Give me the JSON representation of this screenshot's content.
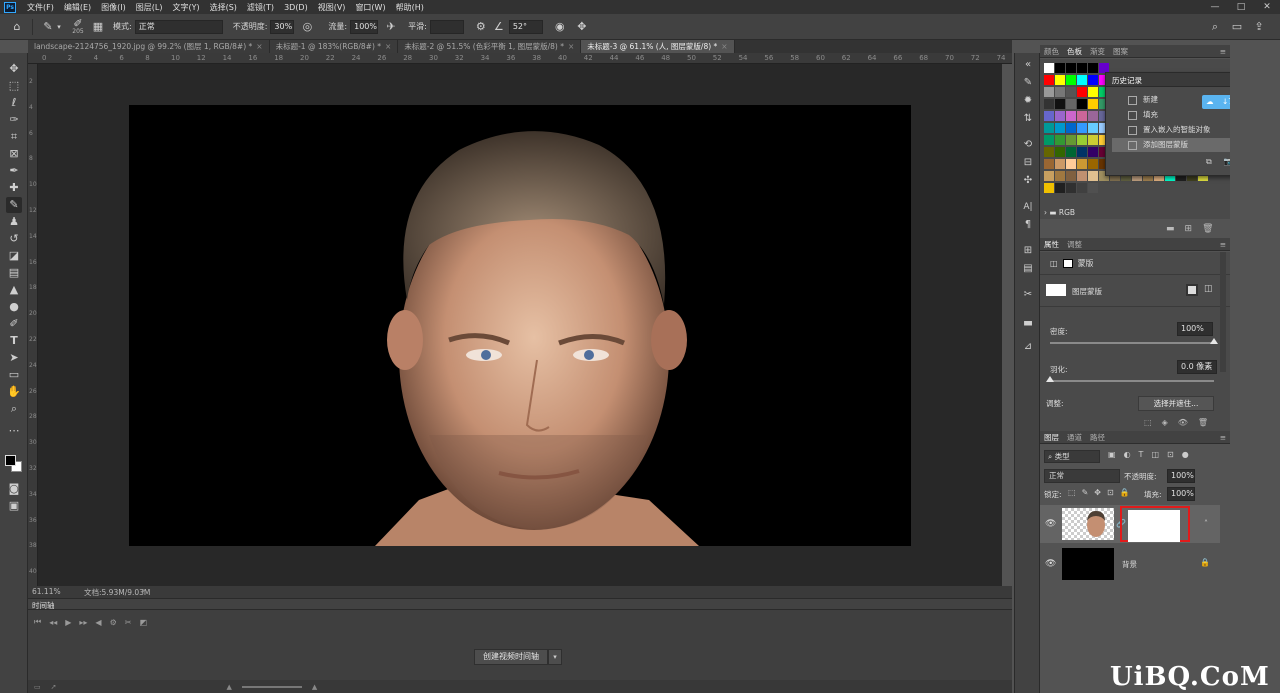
{
  "app": {
    "logo": "Ps",
    "menu": [
      "文件(F)",
      "编辑(E)",
      "图像(I)",
      "图层(L)",
      "文字(Y)",
      "选择(S)",
      "滤镜(T)",
      "3D(D)",
      "视图(V)",
      "窗口(W)",
      "帮助(H)"
    ],
    "window_controls": [
      "—",
      "□",
      "✕"
    ]
  },
  "options": {
    "brush_size": "205",
    "mode_label": "模式:",
    "mode_value": "正常",
    "opacity_label": "不透明度:",
    "opacity_value": "30%",
    "flow_label": "流量:",
    "flow_value": "100%",
    "smooth_label": "平滑:",
    "angle_value": "52°"
  },
  "tabs": [
    {
      "label": "landscape-2124756_1920.jpg @ 99.2% (图层 1, RGB/8#) *",
      "active": false
    },
    {
      "label": "未标题-1 @ 183%(RGB/8#) *",
      "active": false
    },
    {
      "label": "未标题-2 @ 51.5% (色彩平衡 1, 图层蒙版/8) *",
      "active": false
    },
    {
      "label": "未标题-3 @ 61.1% (人, 图层蒙版/8) *",
      "active": true
    }
  ],
  "ruler_h": [
    "0",
    "2",
    "4",
    "6",
    "8",
    "10",
    "12",
    "14",
    "16",
    "18",
    "20",
    "22",
    "24",
    "26",
    "28",
    "30",
    "32",
    "34",
    "36",
    "38",
    "40",
    "42",
    "44",
    "46",
    "48",
    "50",
    "52",
    "54",
    "56",
    "58",
    "60",
    "62",
    "64",
    "66",
    "68",
    "70",
    "72",
    "74"
  ],
  "ruler_v": [
    "2",
    "4",
    "6",
    "8",
    "10",
    "12",
    "14",
    "16",
    "18",
    "20",
    "22",
    "24",
    "26",
    "28",
    "30",
    "32",
    "34",
    "36",
    "38",
    "40"
  ],
  "status": {
    "zoom": "61.11%",
    "doc": "文档:5.93M/9.03M"
  },
  "timeline": {
    "title": "时间轴",
    "create_button": "创建视频时间轴"
  },
  "swatches_panel": {
    "tabs": [
      "颜色",
      "色板",
      "渐变",
      "图案"
    ],
    "active_tab": "色板",
    "folder": "RGB",
    "rows": [
      [
        "#ffffff",
        "#000000",
        "#000000",
        "#000000",
        "#000000",
        "#6600cc"
      ],
      [
        "#ff0000",
        "#ffff00",
        "#00ff00",
        "#00ffff",
        "#0000ff",
        "#ff00ff",
        "#ffffff"
      ],
      [
        "#999999",
        "#777777",
        "#555555",
        "#ff0000",
        "#ffff00",
        "#00cc66",
        "#0066ff"
      ],
      [
        "#333333",
        "#111111",
        "#666666",
        "#000000",
        "#ffcc00",
        "#339966",
        "#3366cc"
      ],
      [
        "#6666cc",
        "#9966cc",
        "#cc66cc",
        "#cc6699",
        "#996699",
        "#666699",
        "#333366"
      ],
      [
        "#009999",
        "#0099cc",
        "#0066cc",
        "#3399ff",
        "#66ccff",
        "#99ccff",
        "#ccccff"
      ],
      [
        "#009966",
        "#339933",
        "#669933",
        "#99cc33",
        "#cccc33",
        "#ffcc33",
        "#ff9933"
      ],
      [
        "#666600",
        "#336600",
        "#006633",
        "#003366",
        "#330066",
        "#660033",
        "#663300"
      ],
      [
        "#996633",
        "#cc9966",
        "#ffcc99",
        "#cc9933",
        "#996600",
        "#663300",
        "#333300"
      ],
      [
        "#c8a060",
        "#a07840",
        "#806040",
        "#c09070",
        "#e0c090",
        "#a09060",
        "#807050",
        "#606040",
        "#c0a080",
        "#a08050",
        "#e0b080",
        "#00ffcc",
        "#202020",
        "#404020",
        "#e0e040"
      ],
      [
        "#f0c000",
        "#202020",
        "#303030",
        "#404040",
        "#505050"
      ]
    ]
  },
  "history_panel": {
    "title": "历史记录",
    "items": [
      "新建",
      "填充",
      "置入嵌入的智能对象",
      "添加图层蒙版"
    ],
    "speed": "↓7.0 MB/s"
  },
  "properties_panel": {
    "tabs": [
      "属性",
      "调整"
    ],
    "mask_label": "蒙版",
    "layer_mask_label": "图层蒙版",
    "density_label": "密度:",
    "density_value": "100%",
    "density_fraction": 1.0,
    "feather_label": "羽化:",
    "feather_value": "0.0 像素",
    "feather_fraction": 0.0,
    "adjust_label": "调整:",
    "select_mask_button": "选择并遮住..."
  },
  "layers_panel": {
    "tabs": [
      "图层",
      "通道",
      "路径"
    ],
    "filter_label": "类型",
    "blend_mode": "正常",
    "opacity_label": "不透明度:",
    "opacity_value": "100%",
    "lock_label": "锁定:",
    "fill_label": "填充:",
    "fill_value": "100%",
    "layers": [
      {
        "name": "",
        "has_mask": true,
        "selected": true
      },
      {
        "name": "背景",
        "has_mask": false,
        "locked": true
      }
    ]
  },
  "watermark": "UiBQ.CoM",
  "colors": {
    "accent": "#31a8ff",
    "highlight": "#e11b1b",
    "menubar": "#323232",
    "panel": "#424242"
  }
}
